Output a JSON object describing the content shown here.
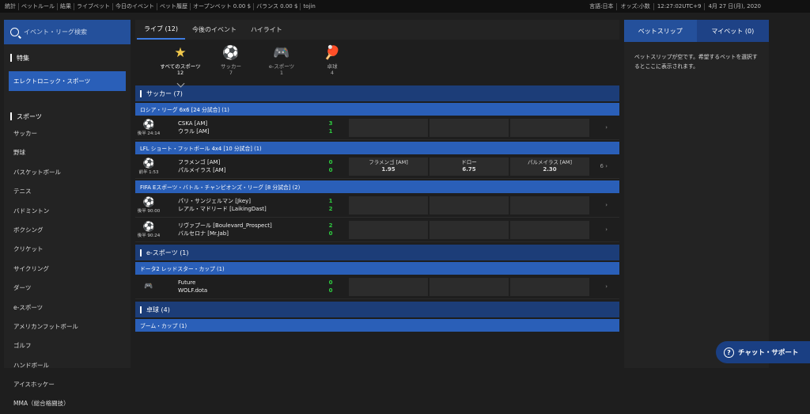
{
  "topbar": {
    "left": [
      "統計",
      "ベットルール",
      "結果",
      "ライブベット",
      "今日のイベント",
      "ベット履歴",
      "オープンベット 0.00 $",
      "バランス 0.00 $",
      "tojin"
    ],
    "right": [
      "言語:日本",
      "オッズ:小数",
      "12:27:02UTC+9",
      "4月 27 日(月), 2020"
    ]
  },
  "sidebar": {
    "search_placeholder": "イベント・リーグ検索",
    "featured_title": "特集",
    "featured_item": "エレクトロニック・スポーツ",
    "sports_title": "スポーツ",
    "sports": [
      "サッカー",
      "野球",
      "バスケットボール",
      "テニス",
      "バドミントン",
      "ボクシング",
      "クリケット",
      "サイクリング",
      "ダーツ",
      "e-スポーツ",
      "アメリカンフットボール",
      "ゴルフ",
      "ハンドボール",
      "アイスホッケー",
      "MMA（総合格闘技）"
    ]
  },
  "main": {
    "tabs": [
      "ライブ (12)",
      "今後のイベント",
      "ハイライト"
    ],
    "sport_icons": [
      {
        "icon": "star-icon",
        "label": "すべてのスポーツ",
        "count": "12"
      },
      {
        "icon": "soccer-ball-icon",
        "label": "サッカー",
        "count": "7"
      },
      {
        "icon": "gamepad-icon",
        "label": "e-スポーツ",
        "count": "1"
      },
      {
        "icon": "table-tennis-icon",
        "label": "卓球",
        "count": "4"
      }
    ],
    "sections": [
      {
        "name": "サッカー (7)",
        "leagues": [
          {
            "name": "ロシア・リーグ 6x6 [24 分試合] (1)",
            "matches": [
              {
                "icon": "soccer-ball-icon",
                "time": "後半 24:14",
                "home": "CSKA [AM]",
                "away": "ウラル [AM]",
                "score_home": "3",
                "score_away": "1",
                "odds": [
                  {
                    "label": "",
                    "value": ""
                  },
                  {
                    "label": "",
                    "value": ""
                  },
                  {
                    "label": "",
                    "value": ""
                  }
                ],
                "more": ""
              }
            ]
          },
          {
            "name": "LFL ショート・フットボール 4x4 [10 分試合] (1)",
            "matches": [
              {
                "icon": "soccer-ball-icon",
                "time": "前半 1:53",
                "home": "フラメンゴ [AM]",
                "away": "パルメイラス [AM]",
                "score_home": "0",
                "score_away": "0",
                "odds": [
                  {
                    "label": "フラメンゴ [AM]",
                    "value": "1.95"
                  },
                  {
                    "label": "ドロー",
                    "value": "6.75"
                  },
                  {
                    "label": "パルメイラス [AM]",
                    "value": "2.30"
                  }
                ],
                "more": "6"
              }
            ]
          },
          {
            "name": "FIFA Eスポーツ・バトル・チャンピオンズ・リーグ [8 分試合] (2)",
            "matches": [
              {
                "icon": "soccer-ball-icon",
                "time": "後半 90:00",
                "home": "パリ・サンジェルマン [Jkey]",
                "away": "レアル・マドリード [LaikingDast]",
                "score_home": "1",
                "score_away": "2",
                "odds": [
                  {
                    "label": "",
                    "value": ""
                  },
                  {
                    "label": "",
                    "value": ""
                  },
                  {
                    "label": "",
                    "value": ""
                  }
                ],
                "more": ""
              },
              {
                "icon": "soccer-ball-icon",
                "time": "後半 90:24",
                "home": "リヴァプール [Boulevard_Prospect]",
                "away": "バルセロナ [Mr.Jab]",
                "score_home": "2",
                "score_away": "0",
                "odds": [
                  {
                    "label": "",
                    "value": ""
                  },
                  {
                    "label": "",
                    "value": ""
                  },
                  {
                    "label": "",
                    "value": ""
                  }
                ],
                "more": ""
              }
            ]
          }
        ]
      },
      {
        "name": "e-スポーツ (1)",
        "leagues": [
          {
            "name": "ドータ2 レッドスター・カップ (1)",
            "matches": [
              {
                "icon": "gamepad-icon",
                "time": "",
                "home": "Future",
                "away": "WOLF.dota",
                "score_home": "0",
                "score_away": "0",
                "odds": [
                  {
                    "label": "",
                    "value": ""
                  },
                  {
                    "label": "",
                    "value": ""
                  },
                  {
                    "label": "",
                    "value": ""
                  }
                ],
                "more": ""
              }
            ]
          }
        ]
      },
      {
        "name": "卓球 (4)",
        "leagues": [
          {
            "name": "ブーム・カップ (1)",
            "matches": []
          }
        ]
      }
    ]
  },
  "betslip": {
    "tab_betslip": "ベットスリップ",
    "tab_mybets": "マイベット (0)",
    "empty_message": "ベットスリップが空です。希望するベットを選択するとここに表示されます。"
  },
  "chat": {
    "label": "チャット・サポート"
  }
}
